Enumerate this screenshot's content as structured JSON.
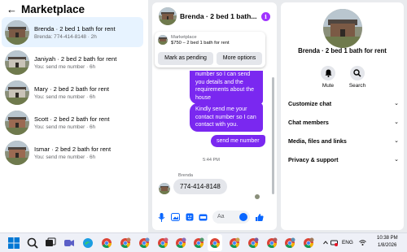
{
  "left": {
    "back_icon": "←",
    "title": "Marketplace",
    "conversations": [
      {
        "name": "Brenda · 2 bed 1 bath for rent",
        "sub": "Brenda: 774-414-8148 · 2h",
        "active": true
      },
      {
        "name": "Janiyah · 2 bed 2 bath for rent",
        "sub": "You: send me number · 6h"
      },
      {
        "name": "Mary · 2 bed 2 bath for rent",
        "sub": "You: send me number · 6h"
      },
      {
        "name": "Scott · 2 bed 2 bath for rent",
        "sub": "You: send me number · 6h"
      },
      {
        "name": "Ismar · 2 bed 2 bath for rent",
        "sub": "You: send me number · 6h"
      }
    ]
  },
  "chat": {
    "title": "Brenda · 2 bed 1 bath...",
    "info_icon": "i",
    "listing": {
      "label": "Marketplace",
      "price_title": "$750 – 2 bed 1 bath for rent",
      "pending_button": "Mark as pending",
      "more_button": "More options"
    },
    "sent": [
      "number so I can send you details and the requirements about the house",
      "Kindly send me your contact number so I can contact with you.",
      "send me number"
    ],
    "timestamp": "5:44 PM",
    "sender": "Brenda",
    "received": "774-414-8148",
    "input_placeholder": "Aa"
  },
  "details": {
    "name": "Brenda · 2 bed 1 bath for rent",
    "mute_label": "Mute",
    "search_label": "Search",
    "sections": [
      "Customize chat",
      "Chat members",
      "Media, files and links",
      "Privacy & support"
    ]
  },
  "taskbar": {
    "language": "ENG",
    "time": "10:38 PM",
    "date": "1/8/2026"
  },
  "colors": {
    "accent": "#0866ff",
    "sent_bubble": "#7a28f0",
    "active_conv": "#e7f3ff"
  }
}
